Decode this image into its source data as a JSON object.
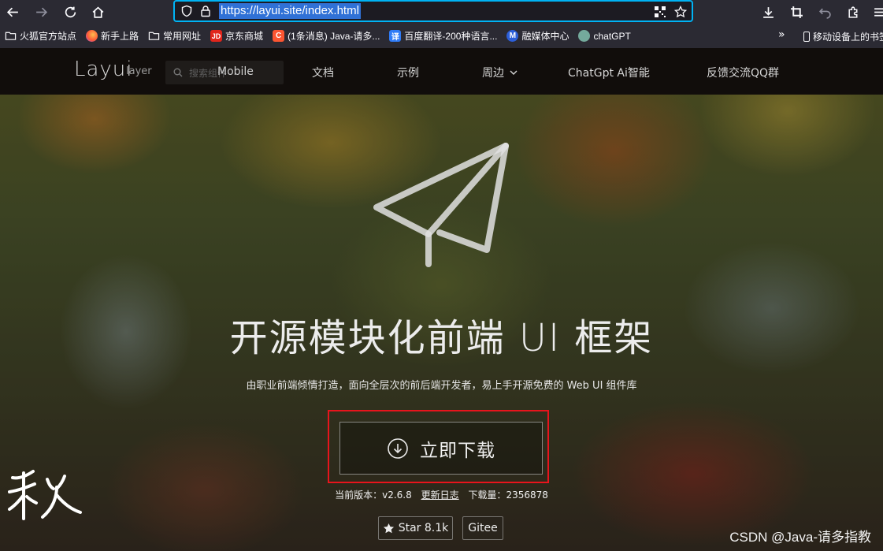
{
  "browser": {
    "url": "https://layui.site/index.html",
    "bookmarks": [
      {
        "label": "火狐官方站点",
        "icon": "folder-icon"
      },
      {
        "label": "新手上路",
        "icon": "firefox-icon"
      },
      {
        "label": "常用网址",
        "icon": "folder-icon"
      },
      {
        "label": "京东商城",
        "icon": "jd-icon",
        "badge": "JD",
        "color": "#e1251b"
      },
      {
        "label": "(1条消息) Java-请多...",
        "icon": "csdn-icon",
        "badge": "C",
        "color": "#fc5531"
      },
      {
        "label": "百度翻译-200种语言...",
        "icon": "baidu-translate-icon",
        "badge": "译",
        "color": "#2f7bf6"
      },
      {
        "label": "融媒体中心",
        "icon": "media-center-icon",
        "badge": "M",
        "color": "#2c5fd9"
      },
      {
        "label": "chatGPT",
        "icon": "chatgpt-icon",
        "badge": "",
        "color": "#74aa9c"
      }
    ],
    "bookmarks_mobile": "移动设备上的书签"
  },
  "site": {
    "logo": "Layui",
    "logo_sub": "layer",
    "search_placeholder": "搜索组件",
    "mobile_label": "Mobile",
    "nav": [
      {
        "label": "文档"
      },
      {
        "label": "示例"
      },
      {
        "label": "周边"
      },
      {
        "label": "ChatGpt Ai智能"
      },
      {
        "label": "反馈交流QQ群"
      }
    ]
  },
  "hero": {
    "title": "开源模块化前端 UI 框架",
    "subtitle": "由职业前端倾情打造，面向全层次的前后端开发者，易上手开源免费的 Web UI 组件库",
    "download_label": "立即下载",
    "version_prefix": "当前版本：",
    "version": "v2.6.8",
    "changelog": "更新日志",
    "downloads_prefix": "下载量：",
    "downloads": "2356878",
    "star_label": "Star 8.1k",
    "gitee_label": "Gitee"
  },
  "overlay": {
    "calligraphy": "秋",
    "watermark": "CSDN @Java-请多指教"
  },
  "colors": {
    "url_focus": "#00b3f4",
    "url_selection": "#3071d6",
    "highlight_box": "#e8141c",
    "site_nav_bg": "#110d0b"
  }
}
